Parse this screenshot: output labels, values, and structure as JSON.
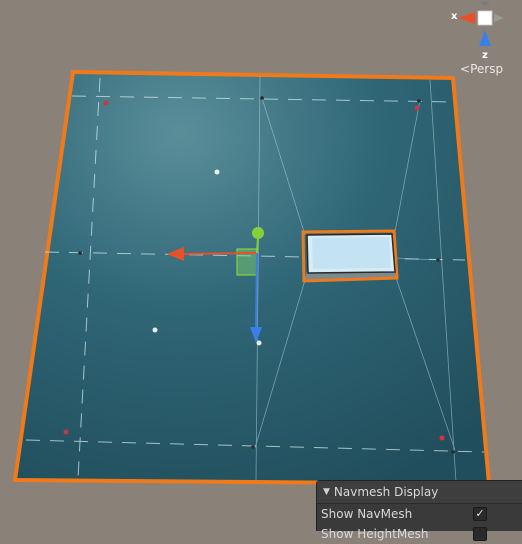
{
  "scene": {
    "camera_mode": "Persp",
    "axis_x_label": "x",
    "axis_z_label": "z"
  },
  "navmesh_panel": {
    "title": "Navmesh Display",
    "rows": [
      {
        "label": "Show NavMesh",
        "checked": true
      },
      {
        "label": "Show HeightMesh",
        "checked": false
      }
    ]
  },
  "colors": {
    "background": "#8a8178",
    "plane": "#2e5f6e",
    "selection_outline": "#f07a1a",
    "gizmo_x": "#e8502a",
    "gizmo_y": "#86d13a",
    "gizmo_z": "#3a7fe8"
  }
}
